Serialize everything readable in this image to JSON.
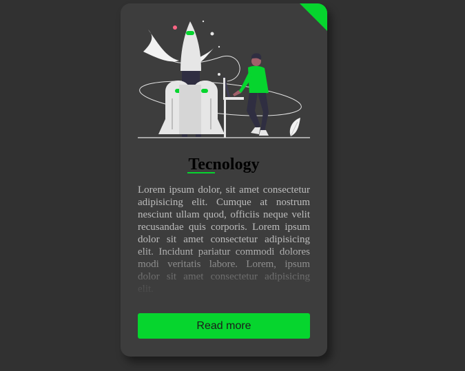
{
  "card": {
    "title": "Tecnology",
    "description": "Lorem ipsum dolor, sit amet consectetur adipisicing elit. Cumque at nostrum nesciunt ullam quod, officiis neque velit recusandae quis corporis. Lorem ipsum dolor sit amet consectetur adipisicing elit. Incidunt pariatur commodi dolores modi veritatis labore. Lorem, ipsum dolor sit amet consectetur adipisicing elit.",
    "button_label": "Read more"
  },
  "colors": {
    "background": "#313131",
    "card": "#3d3d3d",
    "accent": "#06d52e"
  },
  "icons": {
    "illustration": "rocket-launch-illustration",
    "corner": "corner-accent-triangle"
  }
}
